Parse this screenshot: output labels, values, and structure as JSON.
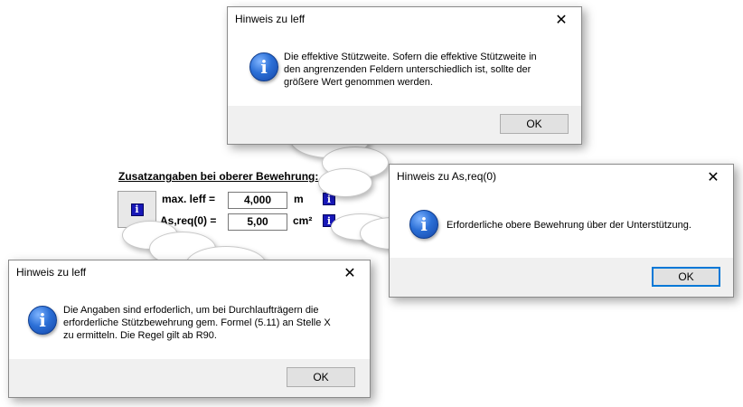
{
  "form": {
    "heading": "Zusatzangaben bei oberer Bewehrung:",
    "rows": [
      {
        "label": "max. leff =",
        "value": "4,000",
        "unit": "m"
      },
      {
        "label": "As,req(0) =",
        "value": "5,00",
        "unit": "cm²"
      }
    ],
    "info_glyph": "i"
  },
  "dialogs": {
    "top": {
      "title": "Hinweis zu leff",
      "message": "Die effektive Stützweite. Sofern die effektive Stützweite in\nden angrenzenden Feldern unterschiedlich ist, sollte der\ngrößere Wert genommen werden.",
      "ok": "OK"
    },
    "right": {
      "title": "Hinweis zu As,req(0)",
      "message": "Erforderliche obere Bewehrung über der Unterstützung.",
      "ok": "OK"
    },
    "bottom": {
      "title": "Hinweis zu leff",
      "message": "Die Angaben sind erfoderlich, um bei Durchlaufträgern die\nerforderliche Stützbewehrung gem. Formel (5.11) an Stelle X\nzu ermitteln. Die Regel gilt ab R90.",
      "ok": "OK"
    },
    "close_glyph": "✕",
    "info_icon_glyph": "i"
  },
  "colors": {
    "info_blue": "#1818b8",
    "footer_gray": "#f0f0f0",
    "focus_blue": "#0078d7"
  }
}
